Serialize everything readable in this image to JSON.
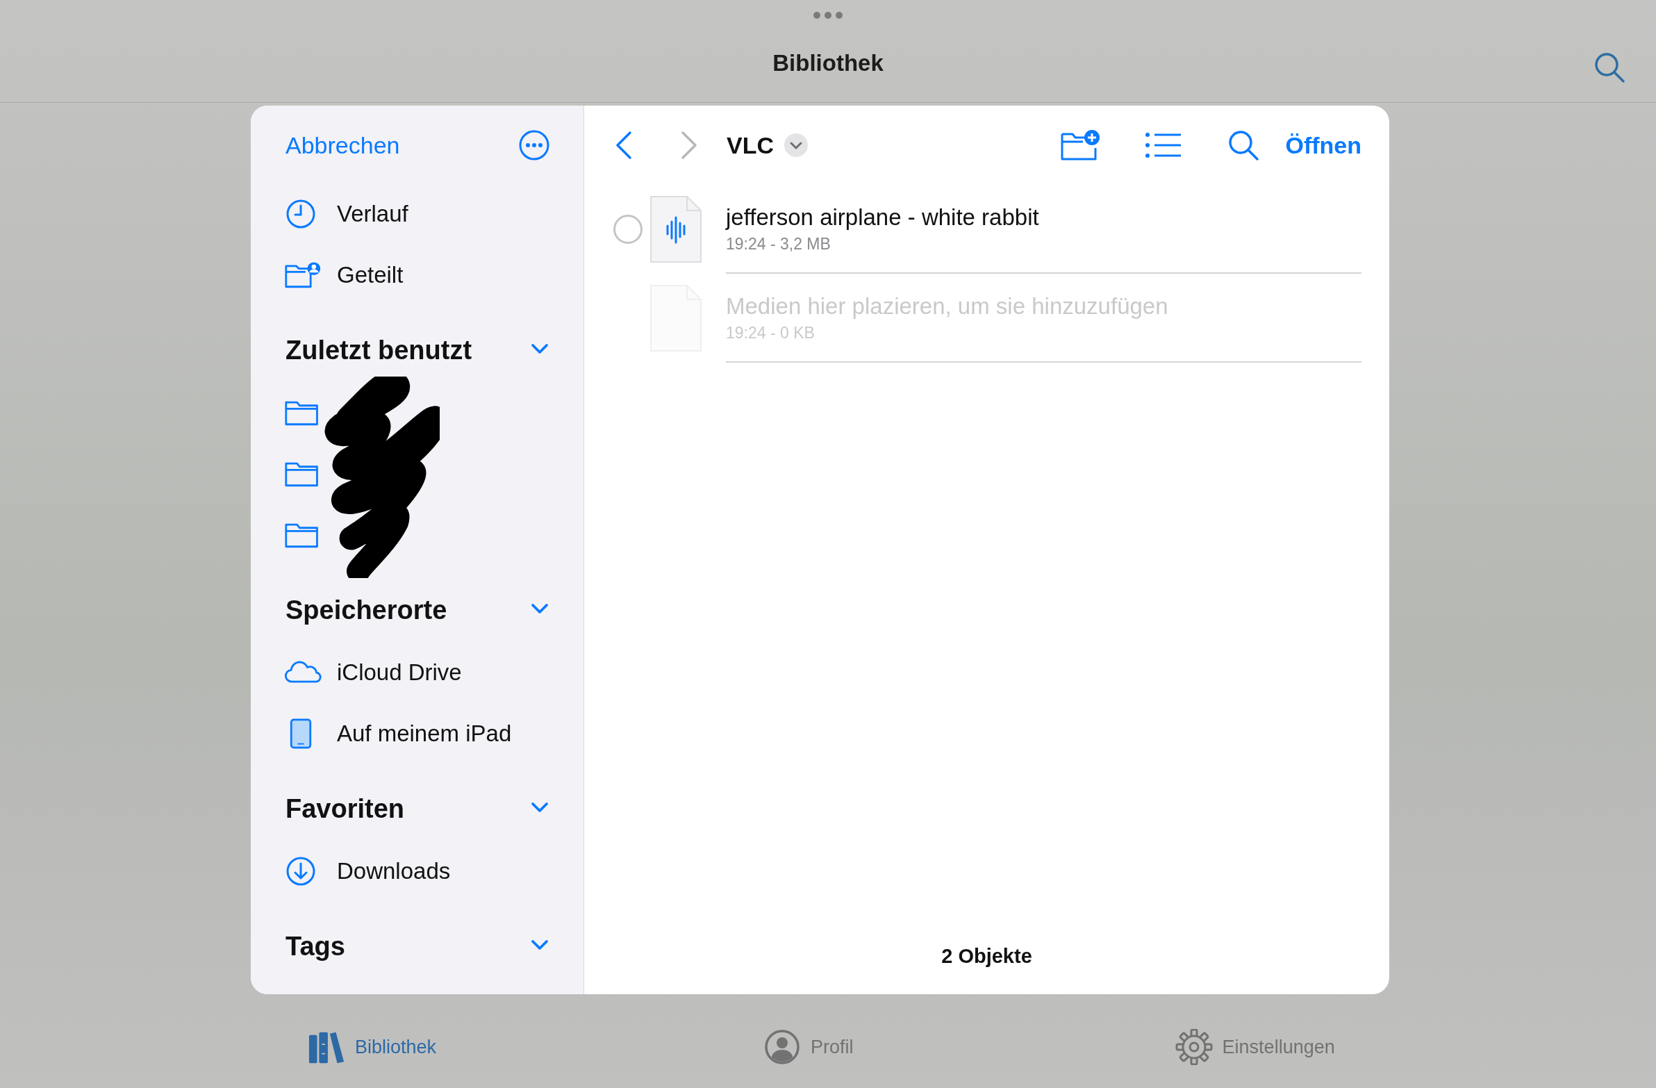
{
  "top_bar": {
    "title": "Bibliothek"
  },
  "sidebar": {
    "cancel": "Abbrechen",
    "items": [
      {
        "label": "Verlauf",
        "kind": "clock"
      },
      {
        "label": "Geteilt",
        "kind": "shared-folder"
      }
    ],
    "sections": [
      {
        "title": "Zuletzt benutzt",
        "expanded": true,
        "redacted": true,
        "items": [
          {
            "kind": "folder"
          },
          {
            "kind": "folder"
          },
          {
            "kind": "folder"
          }
        ]
      },
      {
        "title": "Speicherorte",
        "expanded": true,
        "items": [
          {
            "label": "iCloud Drive",
            "kind": "cloud"
          },
          {
            "label": "Auf meinem iPad",
            "kind": "ipad"
          }
        ]
      },
      {
        "title": "Favoriten",
        "expanded": true,
        "items": [
          {
            "label": "Downloads",
            "kind": "download"
          }
        ]
      },
      {
        "title": "Tags",
        "expanded": true
      }
    ]
  },
  "browser": {
    "folder": "VLC",
    "open": "Öffnen",
    "files": [
      {
        "name": "jefferson airplane - white rabbit",
        "meta": "19:24 - 3,2 MB",
        "kind": "audio",
        "disabled": false,
        "selected": false
      },
      {
        "name": "Medien hier plazieren, um sie hinzuzufügen",
        "meta": "19:24 - 0 KB",
        "kind": "blank",
        "disabled": true,
        "selected": false
      }
    ],
    "count": "2 Objekte"
  },
  "tabs": [
    {
      "label": "Bibliothek",
      "kind": "library",
      "selected": true
    },
    {
      "label": "Profil",
      "kind": "profile",
      "selected": false
    },
    {
      "label": "Einstellungen",
      "kind": "settings",
      "selected": false
    }
  ]
}
